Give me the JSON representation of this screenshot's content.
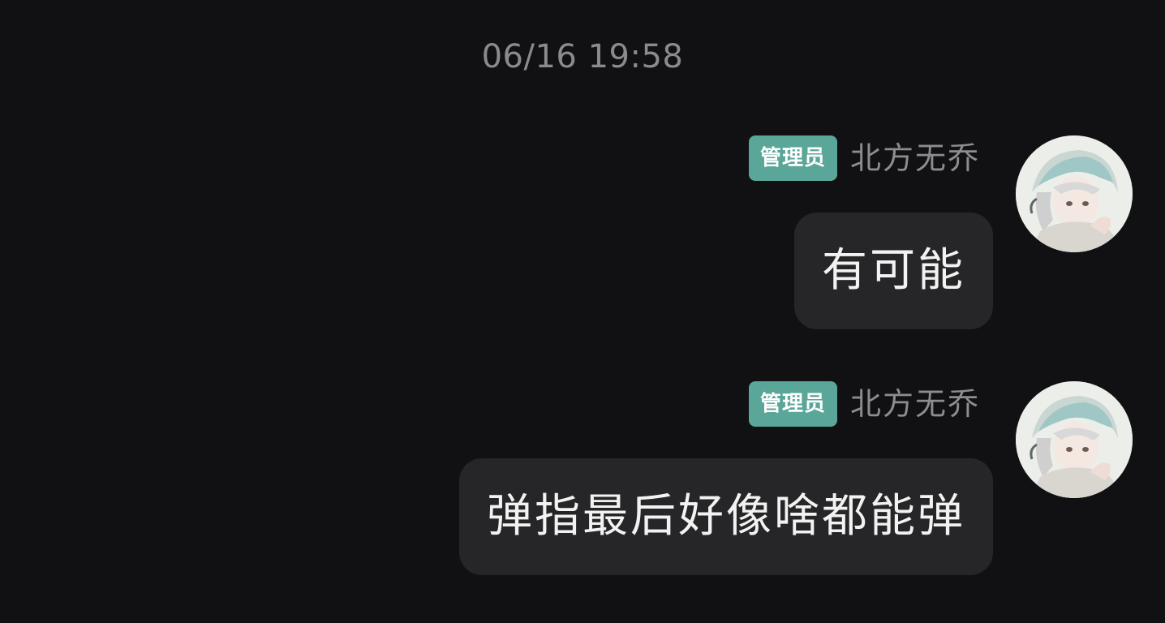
{
  "timestamp": "06/16 19:58",
  "messages": [
    {
      "badge": "管理员",
      "sender": "北方无乔",
      "text": "有可能"
    },
    {
      "badge": "管理员",
      "sender": "北方无乔",
      "text": "弹指最后好像啥都能弹"
    }
  ],
  "colors": {
    "background": "#111113",
    "bubble": "#262628",
    "badge": "#5aa698",
    "meta_text": "#8c8c91"
  }
}
